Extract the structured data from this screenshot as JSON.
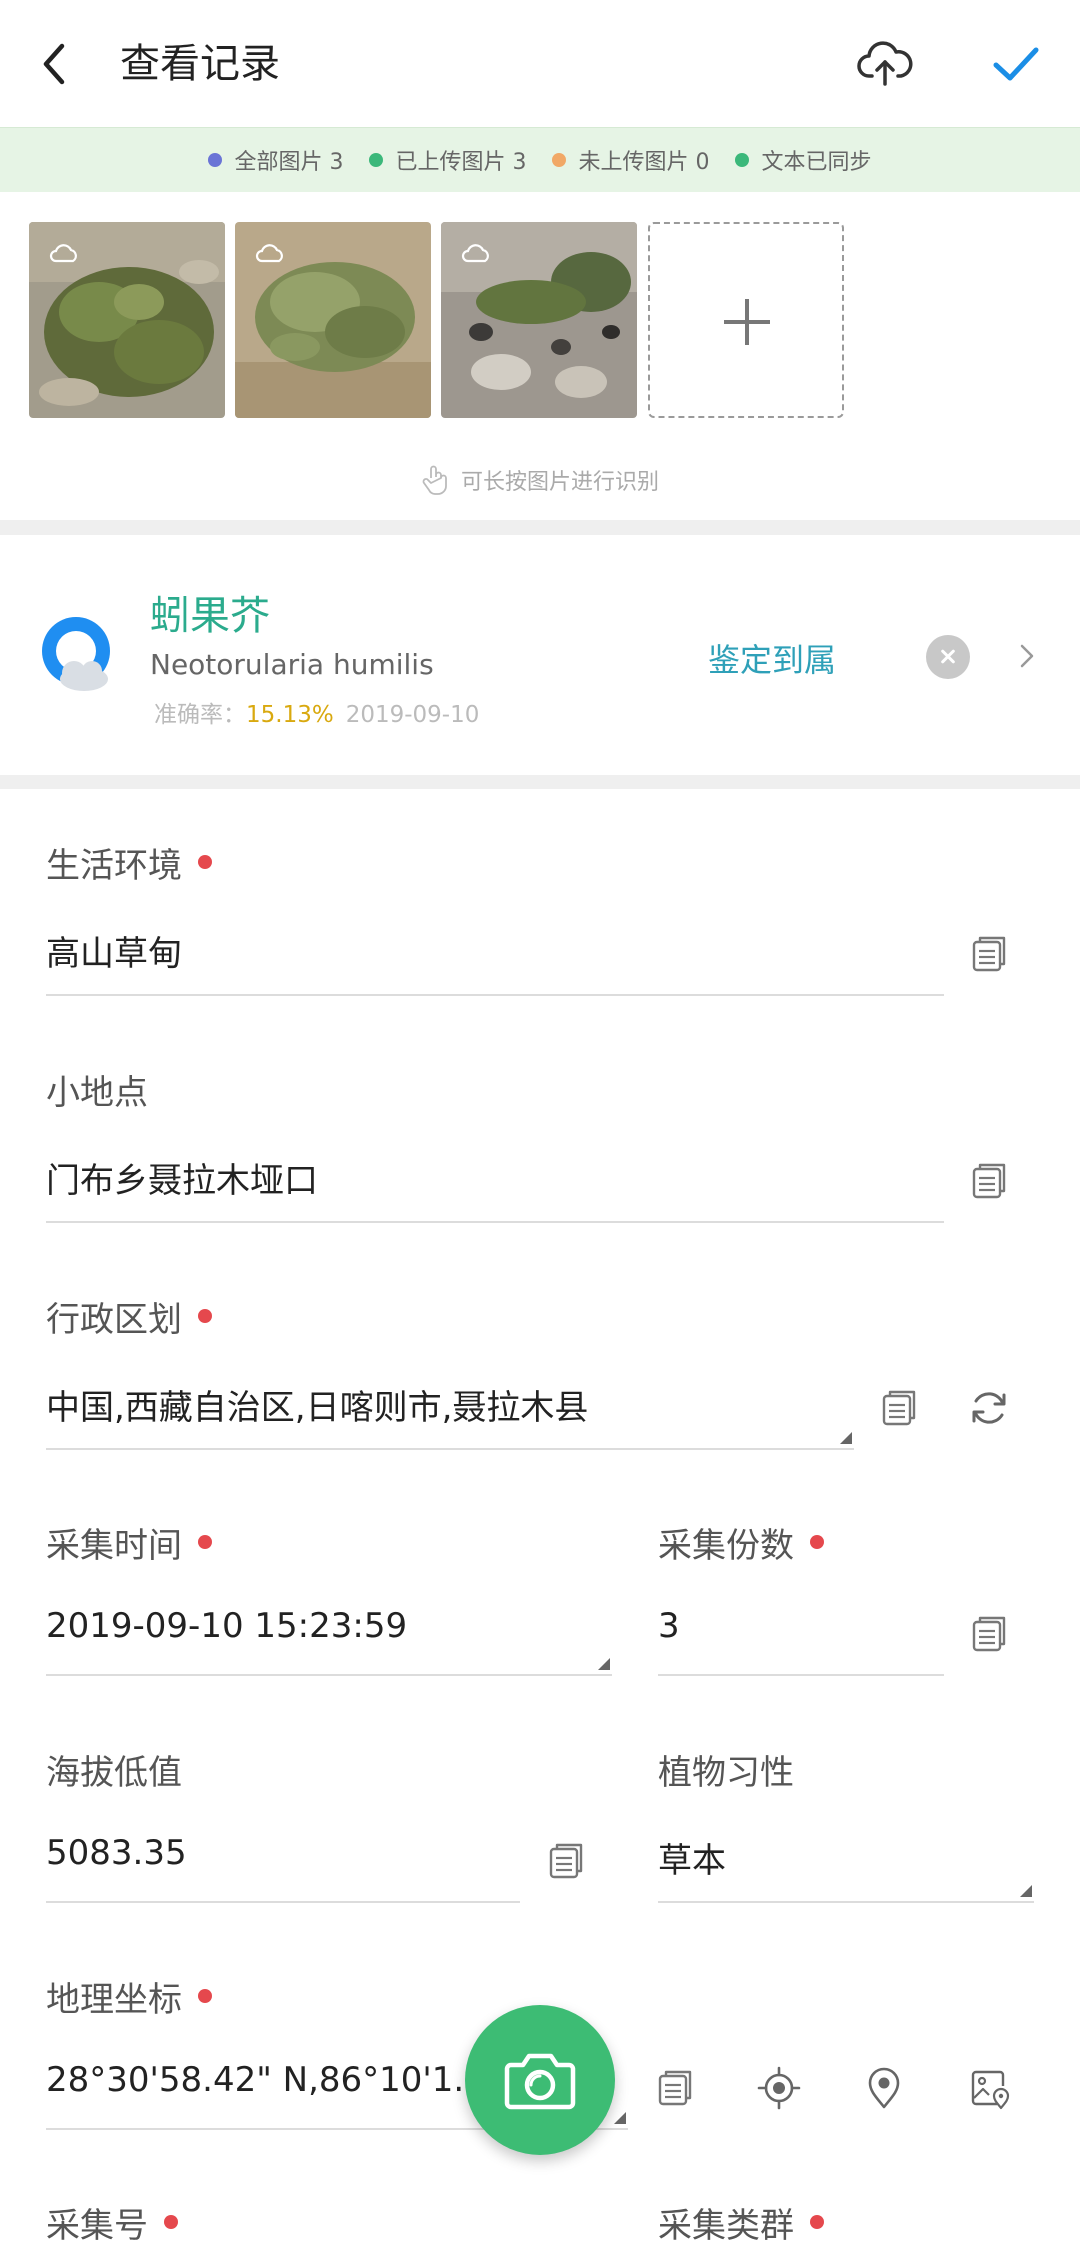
{
  "header": {
    "title": "查看记录",
    "back_icon": "chevron-left-icon",
    "cloud_icon": "cloud-upload-icon",
    "confirm_icon": "check-icon",
    "accent": "#1b8ee6"
  },
  "status_bar": {
    "items": [
      {
        "label": "全部图片 3",
        "color": "#6a74d6"
      },
      {
        "label": "已上传图片 3",
        "color": "#3bb87a"
      },
      {
        "label": "未上传图片 0",
        "color": "#f1a866"
      },
      {
        "label": "文本已同步",
        "color": "#3bb87a"
      }
    ]
  },
  "photos": {
    "count": 3,
    "add_icon": "plus-icon",
    "hint": "可长按图片进行识别"
  },
  "species": {
    "name_cn": "蚓果芥",
    "name_latin": "Neotorularia humilis",
    "accuracy_label": "准确率：",
    "accuracy_value": "15.13%",
    "date": "2019-09-10",
    "identify_label": "鉴定到属"
  },
  "form": {
    "habitat": {
      "label": "生活环境",
      "value": "高山草甸"
    },
    "locality": {
      "label": "小地点",
      "value": "门布乡聂拉木垭口"
    },
    "admin": {
      "label": "行政区划",
      "value": "中国,西藏自治区,日喀则市,聂拉木县"
    },
    "collect_time": {
      "label": "采集时间",
      "value": "2019-09-10 15:23:59"
    },
    "collect_count": {
      "label": "采集份数",
      "value": "3"
    },
    "altitude": {
      "label": "海拔低值",
      "value": "5083.35"
    },
    "habit": {
      "label": "植物习性",
      "value": "草本"
    },
    "coords": {
      "label": "地理坐标",
      "value": "28°30'58.42\" N,86°10'1.17\""
    },
    "collect_no": {
      "label": "采集号"
    },
    "taxon_group": {
      "label": "采集类群"
    }
  },
  "fab": {
    "icon": "camera-icon"
  }
}
